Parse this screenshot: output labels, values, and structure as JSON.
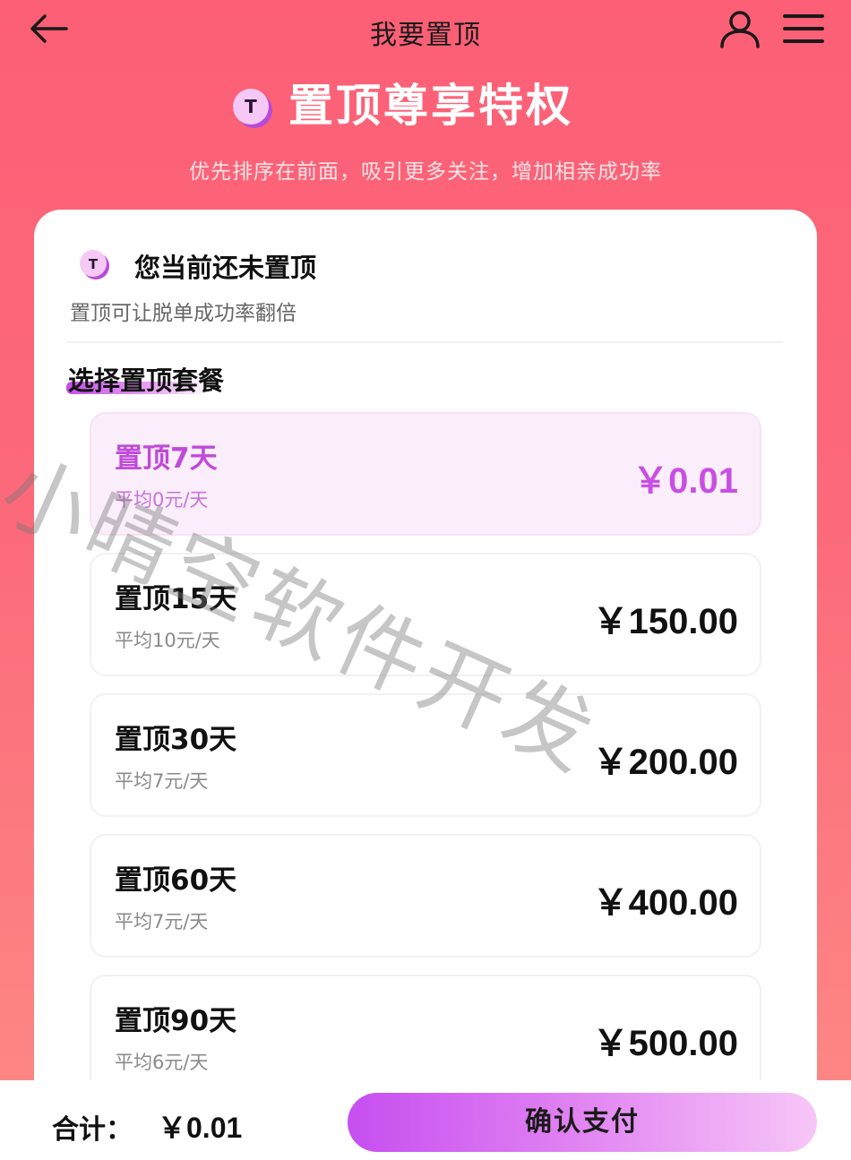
{
  "nav": {
    "title": "我要置顶",
    "icons": {
      "back": "arrow-left-icon",
      "user": "user-icon",
      "menu": "hamburger-menu-icon"
    }
  },
  "hero": {
    "title": "置顶尊享特权",
    "subtitle": "优先排序在前面，吸引更多关注，增加相亲成功率",
    "icon": "pin-badge-icon",
    "badge_letter": "T"
  },
  "status": {
    "title": "您当前还未置顶",
    "subtitle": "置顶可让脱单成功率翻倍"
  },
  "section": {
    "title": "选择置顶套餐"
  },
  "packages": [
    {
      "name": "置顶7天",
      "avg": "平均0元/天",
      "price": "￥0.01",
      "selected": true
    },
    {
      "name": "置顶15天",
      "avg": "平均10元/天",
      "price": "￥150.00",
      "selected": false
    },
    {
      "name": "置顶30天",
      "avg": "平均7元/天",
      "price": "￥200.00",
      "selected": false
    },
    {
      "name": "置顶60天",
      "avg": "平均7元/天",
      "price": "￥400.00",
      "selected": false
    },
    {
      "name": "置顶90天",
      "avg": "平均6元/天",
      "price": "￥500.00",
      "selected": false
    }
  ],
  "footer": {
    "total_label": "合计：",
    "total_value": "￥0.01",
    "pay_label": "确认支付"
  },
  "watermark": "小晴空软件开发",
  "colors": {
    "accent_purple": "#c84fe3",
    "header_gradient_top": "#fc5f76",
    "header_gradient_bottom": "#fd8a86"
  }
}
